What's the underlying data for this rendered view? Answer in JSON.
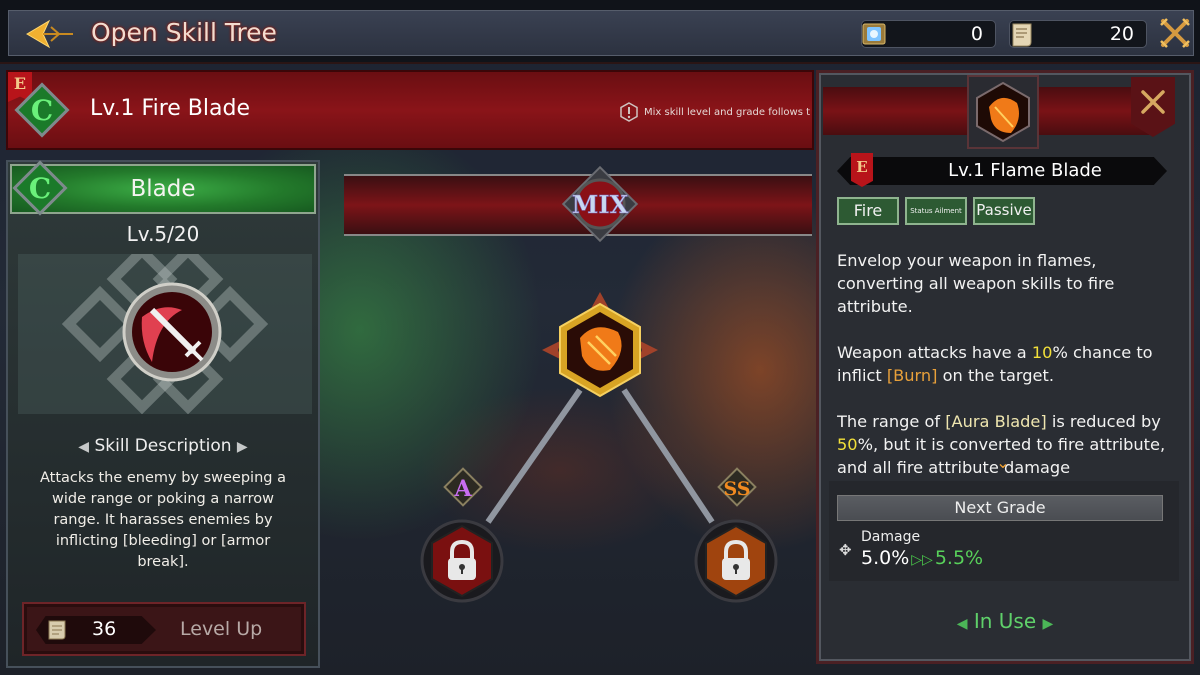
{
  "topbar": {
    "title": "Open Skill Tree",
    "back_icon": "ornate-back-arrow-icon",
    "currencies": [
      {
        "icon": "spellbook-icon",
        "value": "0"
      },
      {
        "icon": "scroll-icon",
        "value": "20"
      }
    ],
    "close_icon": "crossed-swords-close-icon"
  },
  "skill_header": {
    "grade_flag": "E",
    "class_badge": "C",
    "title": "Lv.1  Fire Blade",
    "note": "Mix skill level and grade follows the"
  },
  "left_panel": {
    "class_badge": "C",
    "skill_name": "Blade",
    "level": "Lv.5/20",
    "level_current": 5,
    "level_max": 20,
    "emblem_icon": "sword-slash-icon",
    "description_title": "Skill Description",
    "description": "Attacks the enemy by sweeping a wide range or poking a narrow range. It harasses enemies by inflicting [bleeding] or [armor break].",
    "level_up": {
      "cost": "36",
      "cost_icon": "scroll-icon",
      "label": "Level Up"
    }
  },
  "center": {
    "mix_label": "MIX",
    "main_node": {
      "icon": "flame-blade-icon",
      "selected": true
    },
    "branches": [
      {
        "grade": "A",
        "grade_color": "#c86df0",
        "locked": true,
        "icon": "lock-icon"
      },
      {
        "grade": "SS",
        "grade_color": "#f08a20",
        "locked": true,
        "icon": "lock-icon"
      }
    ]
  },
  "right_panel": {
    "icon": "flame-blade-icon",
    "grade_flag": "E",
    "title": "Lv.1   Flame Blade",
    "tags": [
      "Fire",
      "Status Ailment",
      "Passive"
    ],
    "description": {
      "p1": "Envelop your weapon in flames, converting all weapon skills to fire attribute.",
      "p2_pre": "Weapon attacks have a ",
      "p2_value": "10",
      "p2_mid": "% chance to inflict ",
      "p2_status": "[Burn]",
      "p2_post": " on the target.",
      "p3_pre": "The range of ",
      "p3_skill": "[Aura Blade]",
      "p3_mid": " is reduced by ",
      "p3_value": "50",
      "p3_post": "%, but it is converted to fire attribute, and all fire attribute damage"
    },
    "next_grade": {
      "label": "Next Grade",
      "stat_name": "Damage",
      "current": "5.0%",
      "next": "5.5%"
    },
    "status": "In Use",
    "colors": {
      "highlight_yellow": "#f2e03a",
      "highlight_orange": "#e8a03a",
      "positive_green": "#58d05a"
    }
  }
}
